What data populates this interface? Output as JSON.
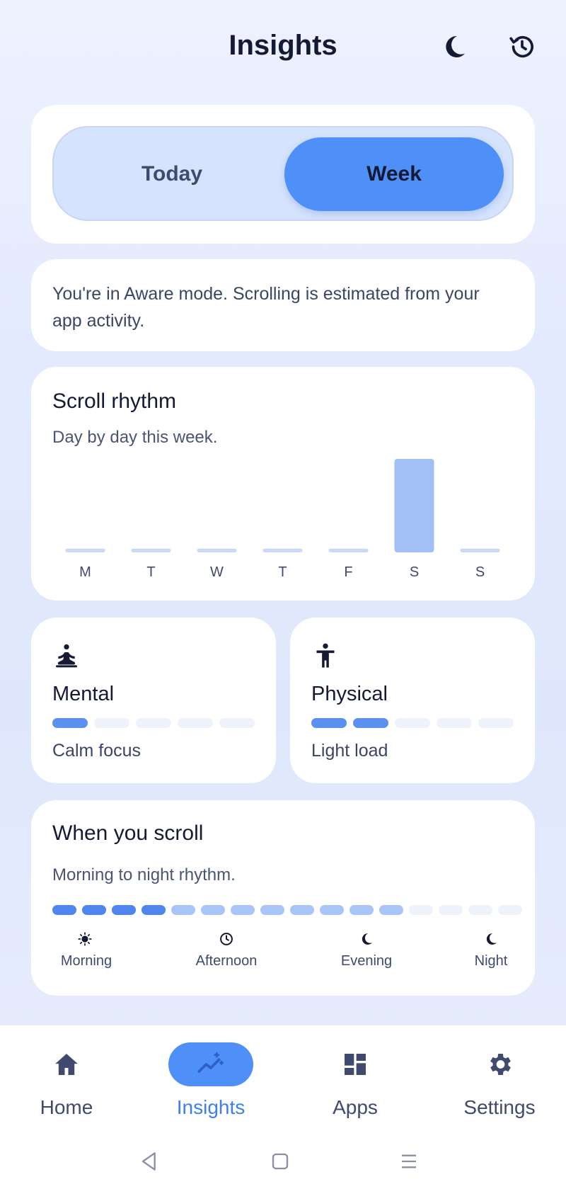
{
  "header": {
    "title": "Insights",
    "icons": [
      "moon-icon",
      "history-icon"
    ]
  },
  "segment": {
    "options": [
      "Today",
      "Week"
    ],
    "selected": "Week"
  },
  "notice": {
    "text": "You're in Aware mode. Scrolling is estimated from your app activity."
  },
  "scroll_rhythm": {
    "title": "Scroll rhythm",
    "subtitle": "Day by day this week.",
    "chart_data": {
      "type": "bar",
      "categories": [
        "M",
        "T",
        "W",
        "T",
        "F",
        "S",
        "S"
      ],
      "values": [
        0.04,
        0.04,
        0.04,
        0.04,
        0.04,
        1.0,
        0.04
      ],
      "ylim": [
        0,
        1
      ],
      "title": "",
      "xlabel": "",
      "ylabel": "",
      "grid": false,
      "colors": {
        "bar": "#a3c0f6",
        "bar_base": "#c9d9f7"
      }
    }
  },
  "mental": {
    "title": "Mental",
    "status": "Calm focus",
    "level": 1,
    "max": 5,
    "icon": "meditation-icon"
  },
  "physical": {
    "title": "Physical",
    "status": "Light load",
    "level": 2,
    "max": 5,
    "icon": "person-standing-icon"
  },
  "when_scroll": {
    "title": "When you scroll",
    "subtitle": "Morning to night rhythm.",
    "segments": [
      "dark",
      "dark",
      "dark",
      "dark",
      "light",
      "light",
      "light",
      "light",
      "light",
      "light",
      "light",
      "light",
      "empty",
      "empty",
      "empty",
      "empty"
    ],
    "periods": [
      {
        "label": "Morning",
        "icon": "sun-icon"
      },
      {
        "label": "Afternoon",
        "icon": "clock-icon"
      },
      {
        "label": "Evening",
        "icon": "moon-icon"
      },
      {
        "label": "Night",
        "icon": "moon-icon"
      }
    ]
  },
  "nav": {
    "items": [
      {
        "label": "Home",
        "icon": "home-icon"
      },
      {
        "label": "Insights",
        "icon": "trending-icon",
        "active": true
      },
      {
        "label": "Apps",
        "icon": "dashboard-icon"
      },
      {
        "label": "Settings",
        "icon": "gear-icon"
      }
    ]
  },
  "colors": {
    "accent": "#4e8ff8",
    "accent_text": "#3f7ef0",
    "title": "#141a33"
  }
}
